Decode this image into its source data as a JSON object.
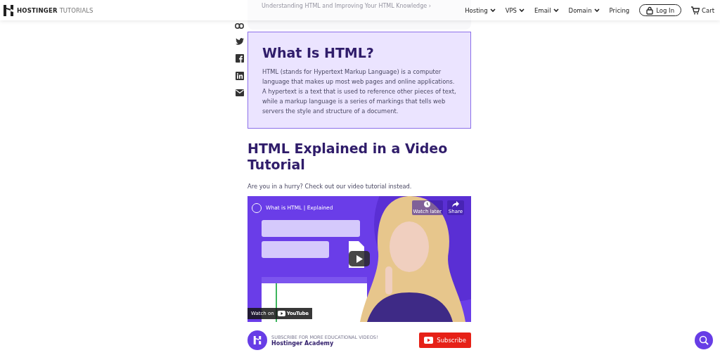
{
  "header": {
    "brand": "HOSTINGER",
    "brand_suffix": "TUTORIALS",
    "nav": [
      {
        "label": "Hosting",
        "dropdown": true
      },
      {
        "label": "VPS",
        "dropdown": true
      },
      {
        "label": "Email",
        "dropdown": true
      },
      {
        "label": "Domain",
        "dropdown": true
      },
      {
        "label": "Pricing",
        "dropdown": false
      }
    ],
    "login": "Log In",
    "cart": "Cart"
  },
  "toc_peek": "Understanding HTML and Improving Your HTML Knowledge ›",
  "share_icons": [
    {
      "kind": "link"
    },
    {
      "kind": "twitter"
    },
    {
      "kind": "facebook"
    },
    {
      "kind": "linkedin"
    },
    {
      "kind": "email"
    }
  ],
  "definition": {
    "title": "What Is HTML?",
    "text": "HTML (stands for Hypertext Markup Language) is a computer language that makes up most web pages and online applications. A hypertext is a text that is used to reference other pieces of text, while a markup language is a series of markings that tells web servers the style and structure of a document."
  },
  "section": {
    "title": "HTML Explained in a Video Tutorial",
    "intro": "Are you in a hurry? Check out our video tutorial instead."
  },
  "video": {
    "kind": "picture",
    "title": "What is HTML | Explained",
    "watch_later": "Watch later",
    "share": "Share",
    "watch_on": "Watch on",
    "platform": "YouTube"
  },
  "channel": {
    "tagline": "SUBSCRIBE FOR MORE EDUCATIONAL VIDEOS!",
    "name": "Hostinger Academy",
    "subscribe": "Subscribe"
  }
}
